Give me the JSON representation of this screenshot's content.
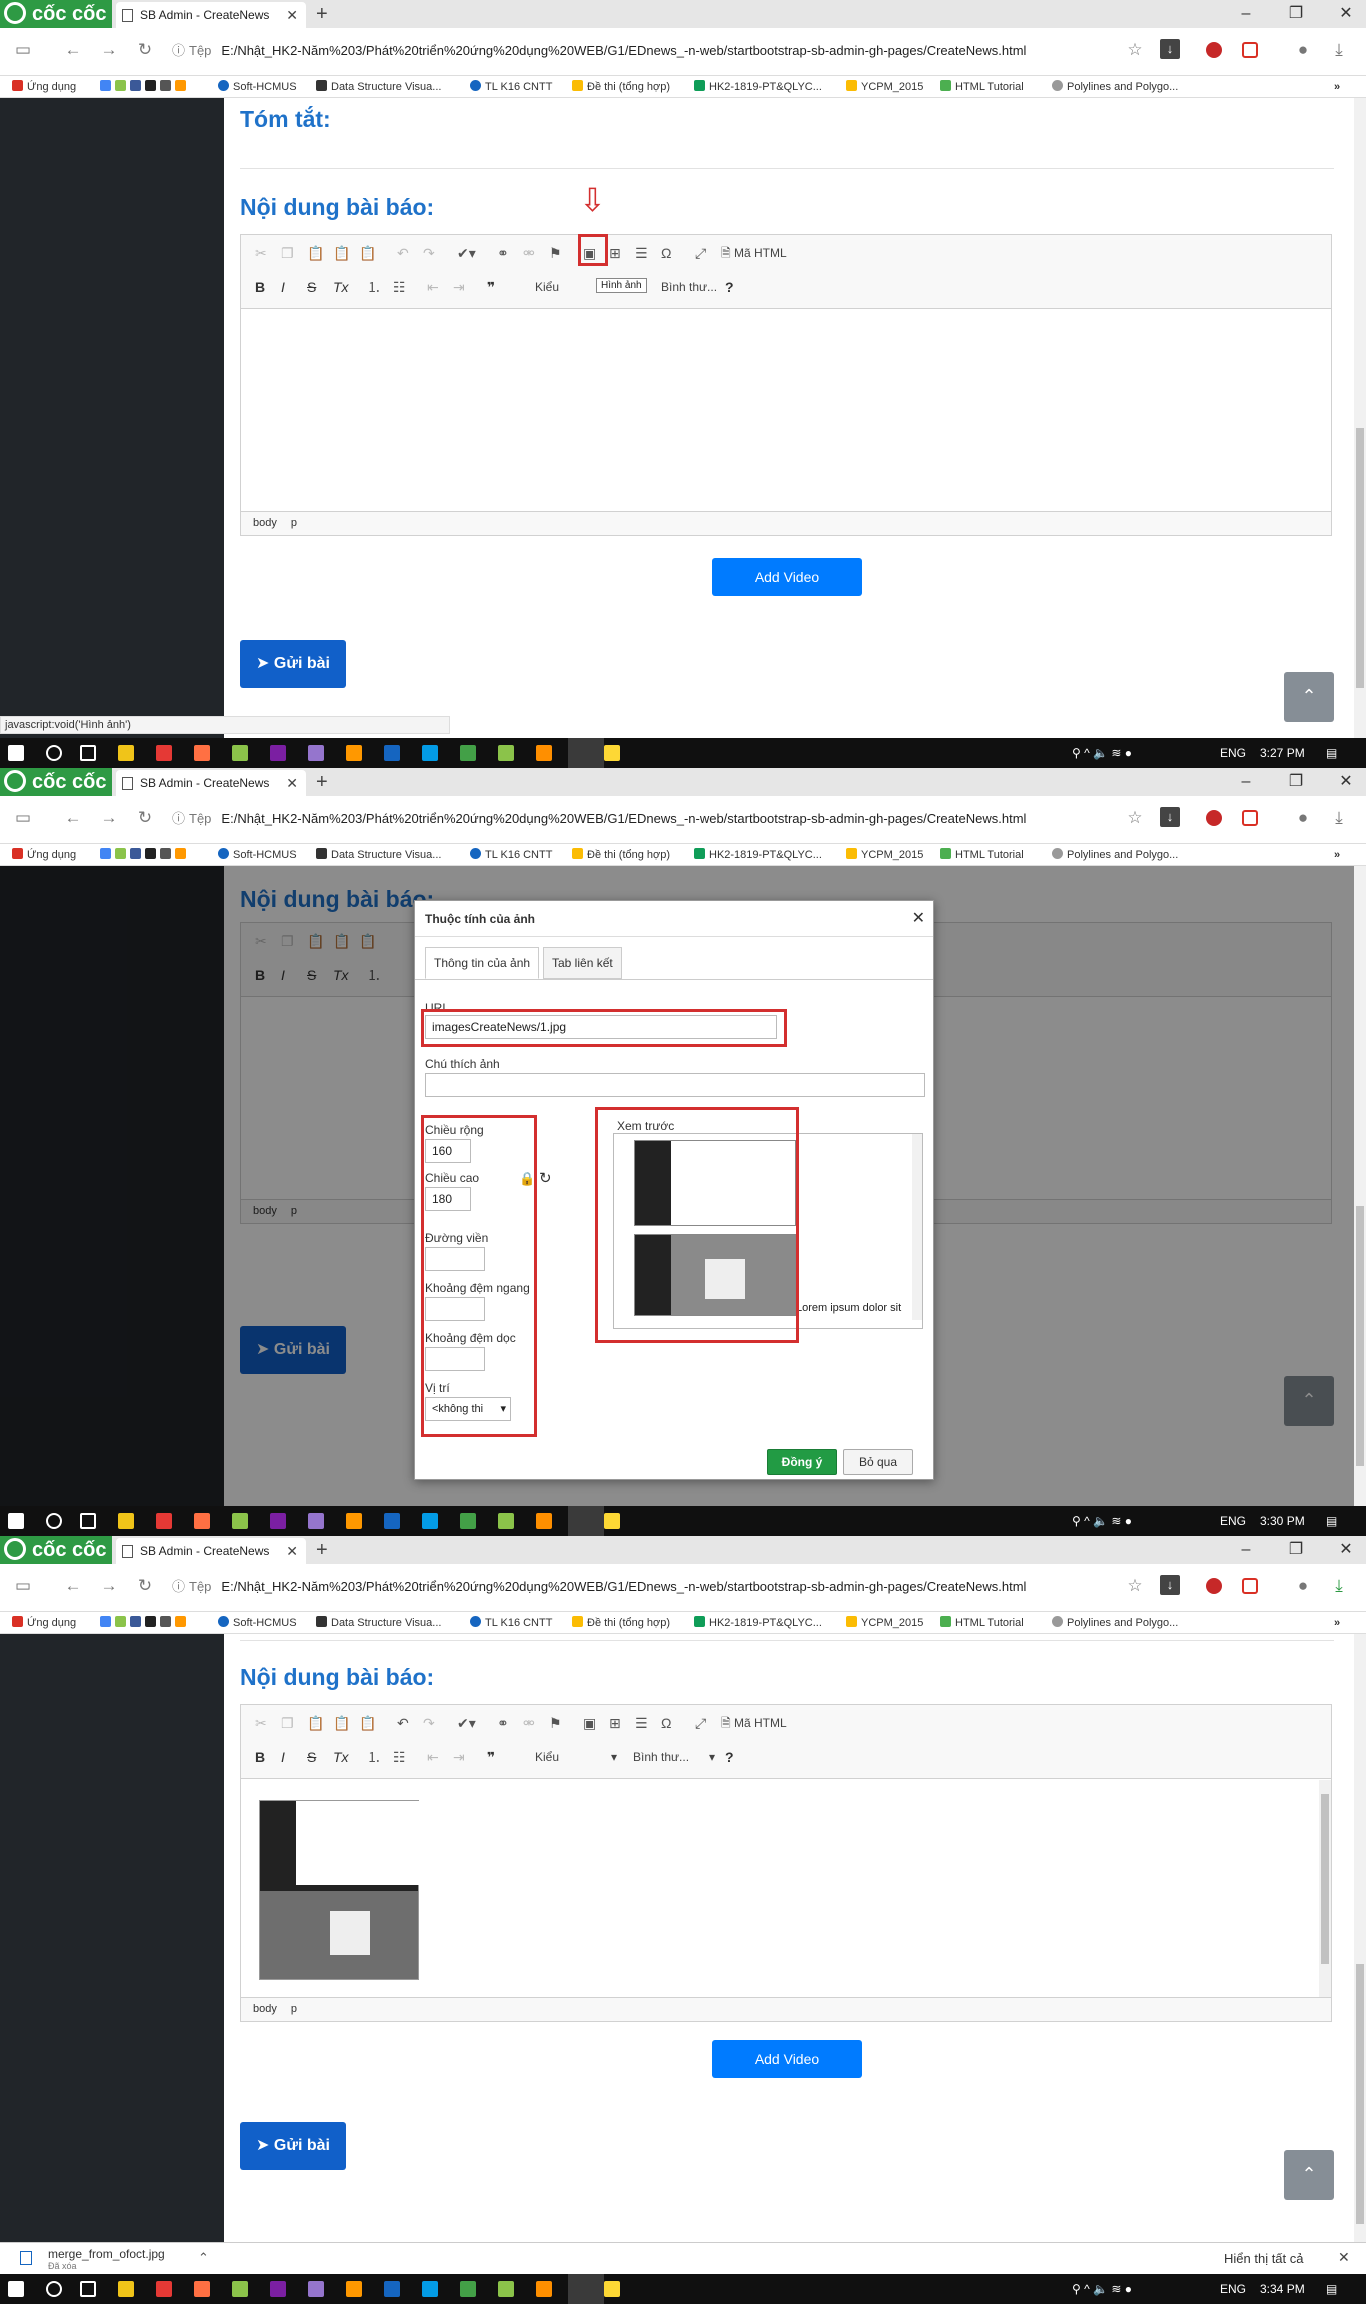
{
  "browser": {
    "brand": "cốc cốc",
    "tab_title": "SB Admin - CreateNews",
    "url_scheme": "Tệp",
    "url": "E:/Nhật_HK2-Năm%203/Phát%20triển%20ứng%20dụng%20WEB/G1/EDnews_-n-web/startbootstrap-sb-admin-gh-pages/CreateNews.html",
    "bookmarks": [
      "Ứng dụng",
      "Soft-HCMUS",
      "Data Structure Visua...",
      "TL K16 CNTT",
      "Đề thi (tổng hợp)",
      "HK2-1819-PT&QLYC...",
      "YCPM_2015",
      "HTML Tutorial",
      "Polylines and Polygo..."
    ],
    "overflow": "»"
  },
  "page": {
    "summary_title": "Tóm tắt:",
    "content_title": "Nội dung bài báo:",
    "add_video": "Add Video",
    "send_button": "Gửi bài",
    "scroll_top": "⌃"
  },
  "editor": {
    "source_label": "Mã HTML",
    "styles_combo": "Kiểu",
    "format_combo": "Bình thư...",
    "help": "?",
    "status_path": [
      "body",
      "p"
    ],
    "image_tooltip": "Hình ảnh"
  },
  "status_link": "javascript:void('Hình ảnh')",
  "dialog": {
    "title": "Thuộc tính của ảnh",
    "tabs": [
      "Thông tin của ảnh",
      "Tab liên kết"
    ],
    "url_label": "URL",
    "url_value": "imagesCreateNews/1.jpg",
    "alt_label": "Chú thích ảnh",
    "width_label": "Chiều rộng",
    "width_value": "160",
    "height_label": "Chiều cao",
    "height_value": "180",
    "border_label": "Đường viền",
    "hspace_label": "Khoảng đệm ngang",
    "vspace_label": "Khoảng đệm dọc",
    "align_label": "Vị trí",
    "align_value": "<không thi",
    "preview_label": "Xem trước",
    "preview_text": "Lorem ipsum dolor sit",
    "ok": "Đồng ý",
    "cancel": "Bỏ qua"
  },
  "taskbar": {
    "lang": "ENG",
    "times": [
      "3:27 PM",
      "3:30 PM",
      "3:34 PM"
    ]
  },
  "downloads": {
    "file_name": "merge_from_ofoct.jpg",
    "file_status": "Đã xóa",
    "show_all": "Hiển thị tất cả"
  },
  "colors": {
    "accent": "#1f72c9",
    "primary": "#007bff",
    "brand_green": "#2e9a44",
    "highlight_red": "#d32f2f",
    "sidebar": "#212529"
  }
}
